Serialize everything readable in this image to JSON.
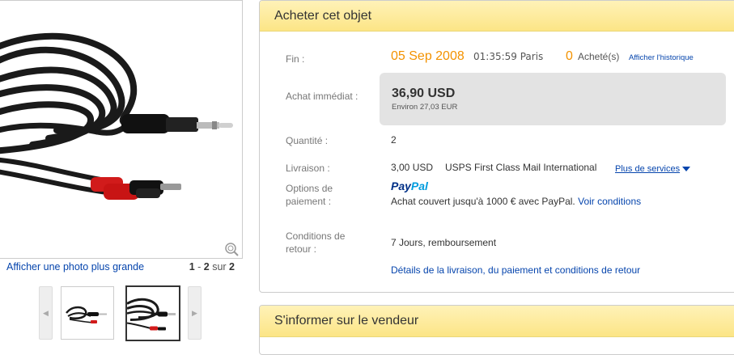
{
  "photo": {
    "enlarge_link": "Afficher une photo plus grande",
    "current": "1",
    "range_sep": " - ",
    "last": "2",
    "of_label": "sur",
    "total": "2"
  },
  "buy_box": {
    "title": "Acheter cet objet",
    "end": {
      "label": "Fin :",
      "date": "05 Sep 2008",
      "time": "01:35:59 Paris",
      "sold_count": "0",
      "sold_label": "Acheté(s)",
      "history_link": "Afficher l'historique"
    },
    "buy_now": {
      "label": "Achat immédiat :",
      "price": "36,90 USD",
      "approx": "Environ 27,03 EUR"
    },
    "quantity": {
      "label": "Quantité :",
      "value": "2"
    },
    "shipping": {
      "label": "Livraison :",
      "cost": "3,00 USD",
      "service": "USPS First Class Mail International",
      "more_link": "Plus de services"
    },
    "payment": {
      "label_line1": "Options de",
      "label_line2": "paiement :",
      "logo_part1": "Pay",
      "logo_part2": "Pal",
      "coverage_text": "Achat couvert jusqu'à 1000 € avec PayPal.",
      "conditions_link": "Voir conditions"
    },
    "returns": {
      "label_line1": "Conditions de",
      "label_line2": "retour :",
      "value": "7 Jours, remboursement"
    },
    "details_link": "Détails de la livraison, du paiement et conditions de retour"
  },
  "seller_box": {
    "title": "S'informer sur le vendeur"
  },
  "colors": {
    "accent_orange": "#f39200",
    "link_blue": "#0645ad",
    "header_yellow": "#fce586",
    "paypal_dark": "#003087",
    "paypal_light": "#009cde"
  },
  "icons": [
    "zoom-magnifier-icon",
    "arrow-left-icon",
    "arrow-right-icon",
    "chevron-down-icon"
  ]
}
